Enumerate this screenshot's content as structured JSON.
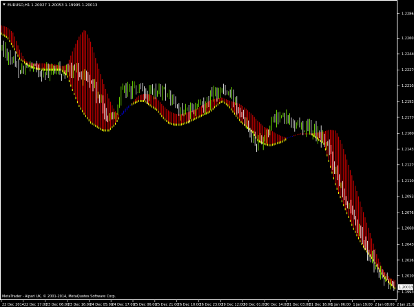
{
  "window": {
    "header_text": "EURUSD,H1  1.20027 1.20053 1.19995 1.20013",
    "footer_text": "MetaTrader - Alpari UK, © 2001-2014, MetaQuotes Software Corp.",
    "current_price_label": "1.20013"
  },
  "chart_data": {
    "type": "candlestick",
    "symbol": "EURUSD",
    "timeframe": "H1",
    "indicator": "Ichimoku cloud (kumo)",
    "price_ticks": [
      "1.22865",
      "1.22605",
      "1.22440",
      "1.22270",
      "1.22105",
      "1.21935",
      "1.21770",
      "1.21600",
      "1.21435",
      "1.21270",
      "1.21100",
      "1.20935",
      "1.20765",
      "1.20600",
      "1.20430",
      "1.20265",
      "1.20100",
      "1.19930"
    ],
    "time_ticks": [
      "22 Dec 2014",
      "22 Dec 17:00",
      "23 Dec 06:00",
      "23 Dec 16:00",
      "24 Dec 05:00",
      "24 Dec 17:00",
      "25 Dec 06:00",
      "25 Dec 21:00",
      "26 Dec 10:00",
      "26 Dec 23:00",
      "29 Dec 12:00",
      "30 Dec 01:00",
      "30 Dec 14:00",
      "31 Dec 03:00",
      "31 Dec 16:00",
      "1 Jan 06:00",
      "1 Jan 19:00",
      "2 Jan 08:00",
      "2 Jan 21:00"
    ],
    "ylim": [
      1.1985,
      1.23
    ],
    "colors": {
      "background": "#000000",
      "bull_candle": "#7cfc00",
      "bear_candle": "#ffffff",
      "kumo_bear": "#cc0000",
      "kumo_bull": "#0000cc",
      "span_b_low": "#ffff00",
      "axis_text": "#ffffff",
      "price_marker": "#ffffff"
    },
    "price_anchors": [
      1.225,
      1.2244,
      1.2235,
      1.2228,
      1.223,
      1.2228,
      1.2226,
      1.2224,
      1.2225,
      1.2227,
      1.2226,
      1.2224,
      1.2225,
      1.2223,
      1.2222,
      1.2214,
      1.22,
      1.2185,
      1.2176,
      1.2182,
      1.2202,
      1.2205,
      1.2206,
      1.2204,
      1.2201,
      1.22,
      1.2203,
      1.2205,
      1.22,
      1.219,
      1.2184,
      1.218,
      1.2183,
      1.2188,
      1.2192,
      1.2197,
      1.2203,
      1.2206,
      1.2202,
      1.2197,
      1.2188,
      1.2174,
      1.216,
      1.215,
      1.2155,
      1.2168,
      1.2176,
      1.2178,
      1.2174,
      1.2172,
      1.217,
      1.2166,
      1.2164,
      1.216,
      1.2154,
      1.2144,
      1.2125,
      1.211,
      1.2088,
      1.2072,
      1.2055,
      1.2044,
      1.203,
      1.2018,
      1.2008,
      1.2003,
      1.1998
    ],
    "span_a_anchors": [
      1.2274,
      1.2272,
      1.2266,
      1.2249,
      1.2237,
      1.2234,
      1.2234,
      1.2234,
      1.2233,
      1.2233,
      1.2231,
      1.2232,
      1.2248,
      1.2262,
      1.227,
      1.2256,
      1.2235,
      1.2215,
      1.2197,
      1.2184,
      1.2178,
      1.2184,
      1.2193,
      1.22,
      1.2202,
      1.2201,
      1.2197,
      1.219,
      1.2184,
      1.2181,
      1.218,
      1.2182,
      1.2184,
      1.2187,
      1.2191,
      1.2195,
      1.2197,
      1.2198,
      1.2195,
      1.2193,
      1.2191,
      1.2186,
      1.218,
      1.2173,
      1.2167,
      1.2164,
      1.216,
      1.2157,
      1.2155,
      1.2158,
      1.216,
      1.216,
      1.216,
      1.2161,
      1.2162,
      1.2164,
      1.2163,
      1.215,
      1.213,
      1.211,
      1.209,
      1.207,
      1.205,
      1.203,
      1.2016,
      1.2008,
      1.2005
    ],
    "span_b_anchors": [
      1.2266,
      1.2262,
      1.2252,
      1.224,
      1.2235,
      1.2231,
      1.2229,
      1.2228,
      1.2228,
      1.2228,
      1.2228,
      1.2222,
      1.2205,
      1.219,
      1.218,
      1.2172,
      1.2168,
      1.2164,
      1.2164,
      1.217,
      1.218,
      1.2188,
      1.2192,
      1.2195,
      1.2195,
      1.219,
      1.2186,
      1.2178,
      1.2172,
      1.217,
      1.217,
      1.2172,
      1.2175,
      1.2178,
      1.2181,
      1.2184,
      1.219,
      1.2195,
      1.219,
      1.2182,
      1.2174,
      1.2168,
      1.2163,
      1.2153,
      1.215,
      1.2148,
      1.215,
      1.2152,
      1.2156,
      1.2158,
      1.216,
      1.216,
      1.216,
      1.2155,
      1.215,
      1.2128,
      1.2106,
      1.209,
      1.2075,
      1.206,
      1.2048,
      1.2038,
      1.203,
      1.202,
      1.201,
      1.2003,
      1.1997
    ],
    "grid": false,
    "legend": "none"
  }
}
